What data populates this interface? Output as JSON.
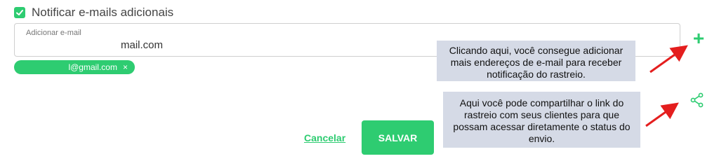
{
  "notify": {
    "checked": true,
    "label": "Notificar e-mails adicionais"
  },
  "email_input": {
    "label": "Adicionar e-mail",
    "value": "mail.com"
  },
  "chips": [
    {
      "text": "l@gmail.com",
      "close": "×"
    }
  ],
  "tooltips": {
    "add": "Clicando aqui, você consegue adicionar mais endereços de e-mail para receber notificação do rastreio.",
    "share": "Aqui você pode compartilhar o link do rastreio com seus clientes para que possam acessar diretamente o status do envio."
  },
  "actions": {
    "add_symbol": "+",
    "cancel_label": "Cancelar",
    "save_label": "SALVAR"
  },
  "colors": {
    "accent": "#2ecc71",
    "tooltip_bg": "#d5dae6",
    "arrow": "#e41e1e"
  },
  "icons": {
    "checkbox": "check-icon",
    "add": "plus-icon",
    "share": "share-icon",
    "chip_close": "close-icon"
  }
}
